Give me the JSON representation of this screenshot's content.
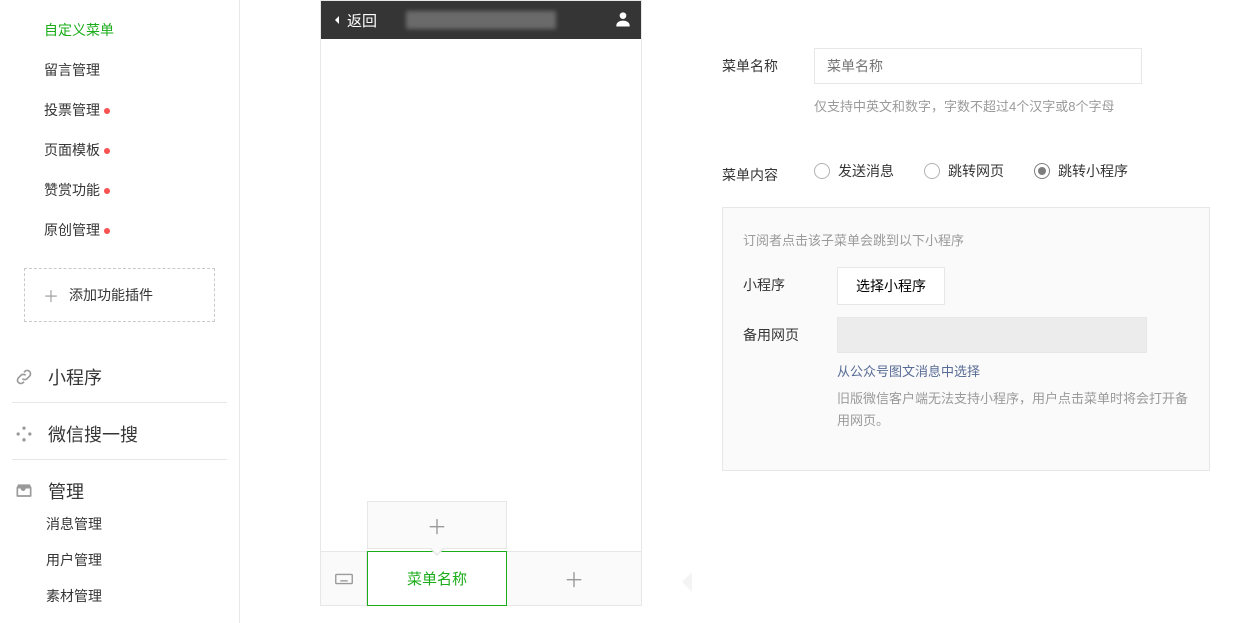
{
  "sidebar": {
    "items": [
      {
        "label": "自定义菜单",
        "active": true,
        "dot": false
      },
      {
        "label": "留言管理",
        "active": false,
        "dot": false
      },
      {
        "label": "投票管理",
        "active": false,
        "dot": true
      },
      {
        "label": "页面模板",
        "active": false,
        "dot": true
      },
      {
        "label": "赞赏功能",
        "active": false,
        "dot": true
      },
      {
        "label": "原创管理",
        "active": false,
        "dot": true
      }
    ],
    "add_plugin": "添加功能插件",
    "sections": [
      {
        "title": "小程序",
        "items": []
      },
      {
        "title": "微信搜一搜",
        "items": []
      },
      {
        "title": "管理",
        "items": [
          "消息管理",
          "用户管理",
          "素材管理"
        ]
      }
    ]
  },
  "phone": {
    "back": "返回",
    "menu_name_placeholder": "菜单名称"
  },
  "form": {
    "name_label": "菜单名称",
    "name_placeholder": "菜单名称",
    "name_hint": "仅支持中英文和数字，字数不超过4个汉字或8个字母",
    "content_label": "菜单内容",
    "radios": {
      "msg": "发送消息",
      "web": "跳转网页",
      "mini": "跳转小程序"
    },
    "panel": {
      "desc": "订阅者点击该子菜单会跳到以下小程序",
      "mini_label": "小程序",
      "choose_btn": "选择小程序",
      "backup_label": "备用网页",
      "link": "从公众号图文消息中选择",
      "note": "旧版微信客户端无法支持小程序，用户点击菜单时将会打开备用网页。"
    }
  }
}
